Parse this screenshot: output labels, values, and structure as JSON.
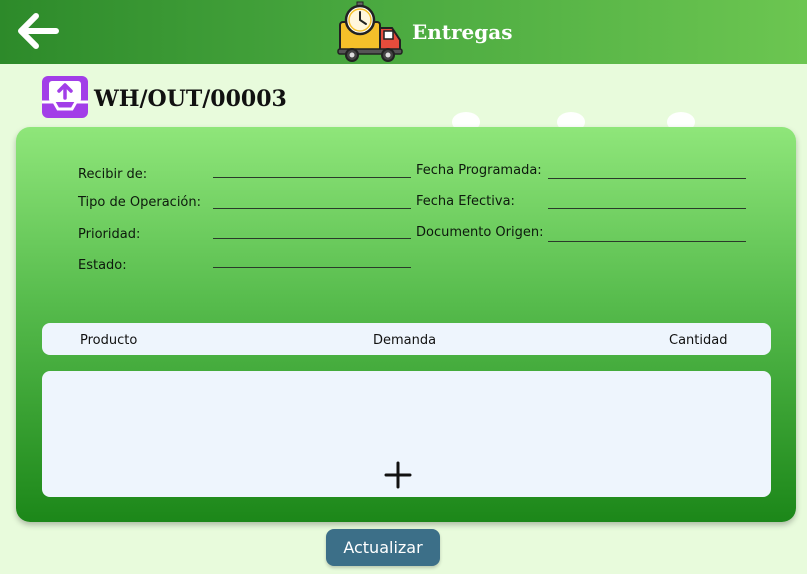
{
  "header": {
    "title": "Entregas",
    "back_icon": "back-arrow-icon",
    "logo_icon": "delivery-truck-clock-icon"
  },
  "document": {
    "reference": "WH/OUT/00003",
    "icon": "outbox-upload-icon"
  },
  "form": {
    "left": [
      {
        "label": "Recibir de:",
        "value": ""
      },
      {
        "label": "Tipo de Operación:",
        "value": ""
      },
      {
        "label": "Prioridad:",
        "value": ""
      },
      {
        "label": "Estado:",
        "value": ""
      }
    ],
    "right": [
      {
        "label": "Fecha Programada:",
        "value": ""
      },
      {
        "label": "Fecha Efectiva:",
        "value": ""
      },
      {
        "label": "Documento Origen:",
        "value": ""
      }
    ]
  },
  "table": {
    "columns": [
      "Producto",
      "Demanda",
      "Cantidad"
    ],
    "rows": [],
    "add_icon": "plus-icon"
  },
  "actions": {
    "update_label": "Actualizar"
  },
  "colors": {
    "header_start": "#2d8a2a",
    "header_end": "#6cc651",
    "background": "#e8fbdc",
    "card_top": "#8fe67a",
    "card_bottom": "#1c8719",
    "button": "#3c6f88",
    "icon_purple": "#a23ee8"
  }
}
